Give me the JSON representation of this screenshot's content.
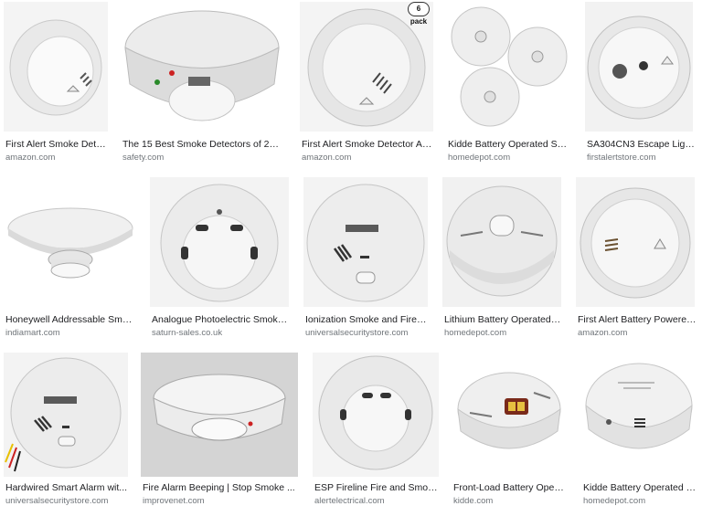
{
  "results": [
    {
      "title": "First Alert Smoke Dete...",
      "source": "amazon.com"
    },
    {
      "title": "The 15 Best Smoke Detectors of 2019 ...",
      "source": "safety.com"
    },
    {
      "title": "First Alert Smoke Detector Ala...",
      "source": "amazon.com",
      "badge": "6 pack"
    },
    {
      "title": "Kidde Battery Operated Smo...",
      "source": "homedepot.com"
    },
    {
      "title": "SA304CN3 Escape Light...",
      "source": "firstalertstore.com"
    },
    {
      "title": "Honeywell Addressable Smok...",
      "source": "indiamart.com"
    },
    {
      "title": "Analogue Photoelectric Smoke ...",
      "source": "saturn-sales.co.uk"
    },
    {
      "title": "Ionization Smoke and Fire Al...",
      "source": "universalsecuritystore.com"
    },
    {
      "title": "Lithium Battery Operated S...",
      "source": "homedepot.com"
    },
    {
      "title": "First Alert Battery Powered...",
      "source": "amazon.com"
    },
    {
      "title": "Hardwired Smart Alarm wit...",
      "source": "universalsecuritystore.com"
    },
    {
      "title": "Fire Alarm Beeping | Stop Smoke ...",
      "source": "improvenet.com"
    },
    {
      "title": "ESP Fireline Fire and Smoke ...",
      "source": "alertelectrical.com"
    },
    {
      "title": "Front-Load Battery Operat...",
      "source": "kidde.com"
    },
    {
      "title": "Kidde Battery Operated S...",
      "source": "homedepot.com"
    }
  ]
}
